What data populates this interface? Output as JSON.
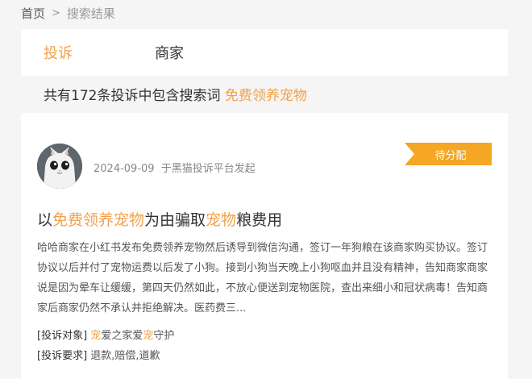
{
  "breadcrumb": {
    "home": "首页",
    "separator": ">",
    "current": "搜索结果"
  },
  "tabs": [
    {
      "label": "投诉",
      "active": true
    },
    {
      "label": "商家",
      "active": false
    }
  ],
  "summary": {
    "prefix": "共有172条投诉中包含搜索词",
    "keyword": "免费领养宠物"
  },
  "complaint": {
    "avatar_icon": "cat-avatar",
    "date": "2024-09-09",
    "source": "于黑猫投诉平台发起",
    "status": "待分配",
    "title_parts": [
      "以",
      "免费领养宠物",
      "为由骗取",
      "宠物",
      "粮费用"
    ],
    "description": "哈哈商家在小红书发布免费领养宠物然后诱导到微信沟通，签订一年狗粮在该商家购买协议。签订协议以后并付了宠物运费以后发了小狗。接到小狗当天晚上小狗呕血并且没有精神，告知商家商家说是因为晕车让缓缓，第四天仍然如此，不放心便送到宠物医院，查出来细小和冠状病毒！告知商家后商家仍然不承认并拒绝解决。医药费三...",
    "target_label": "[投诉对象]",
    "target_parts": [
      "宠",
      "爱之家爱",
      "宠",
      "守护"
    ],
    "demand_label": "[投诉要求]",
    "demand": "退款,赔偿,道歉"
  },
  "colors": {
    "accent": "#f2a14b",
    "status_bg": "#f5a623",
    "page_bg": "#f5f5f5"
  }
}
